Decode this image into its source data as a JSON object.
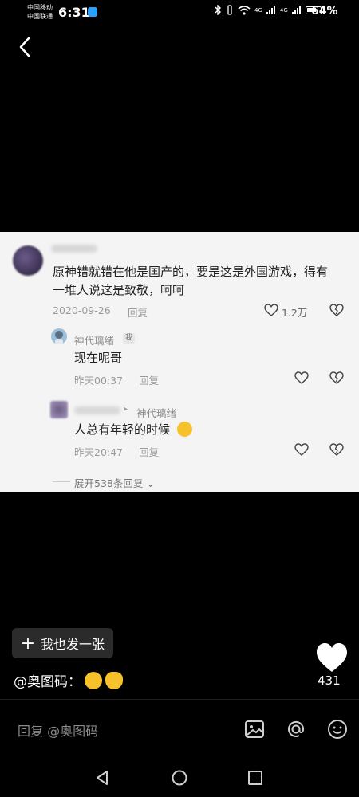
{
  "status_bar": {
    "carrier_1": "中国移动",
    "carrier_2": "中国联通",
    "time": "6:31",
    "network_1": "4G",
    "network_2": "4G",
    "battery": "64%"
  },
  "comments": [
    {
      "text_line1": "原神错就错在他是国产的，要是这是外国游戏，得有",
      "text_line2": "一堆人说这是致敬，呵呵",
      "date": "2020-09-26",
      "reply_label": "回复",
      "likes": "1.2万"
    },
    {
      "author": "神代璃绪",
      "author_tag": "我",
      "text": "现在呢哥",
      "date": "昨天00:37",
      "reply_label": "回复"
    },
    {
      "reply_to": "神代璃绪",
      "text": "人总有年轻的时候",
      "date": "昨天20:47",
      "reply_label": "回复"
    }
  ],
  "expand_replies": "展开538条回复",
  "post_button_label": "我也发一张",
  "caption": "@奥图码：",
  "like_count": "431",
  "reply_placeholder": "回复 @奥图码",
  "colors": {
    "background": "#000000",
    "card": "#f4f4f4",
    "post_button": "#2b2b2b",
    "muted_text": "#8a8a8a"
  },
  "icons": [
    "back-arrow-icon",
    "heart-icon",
    "dislike-icon",
    "image-icon",
    "at-icon",
    "emoji-icon",
    "nav-back-icon",
    "nav-home-icon",
    "nav-recents-icon"
  ]
}
